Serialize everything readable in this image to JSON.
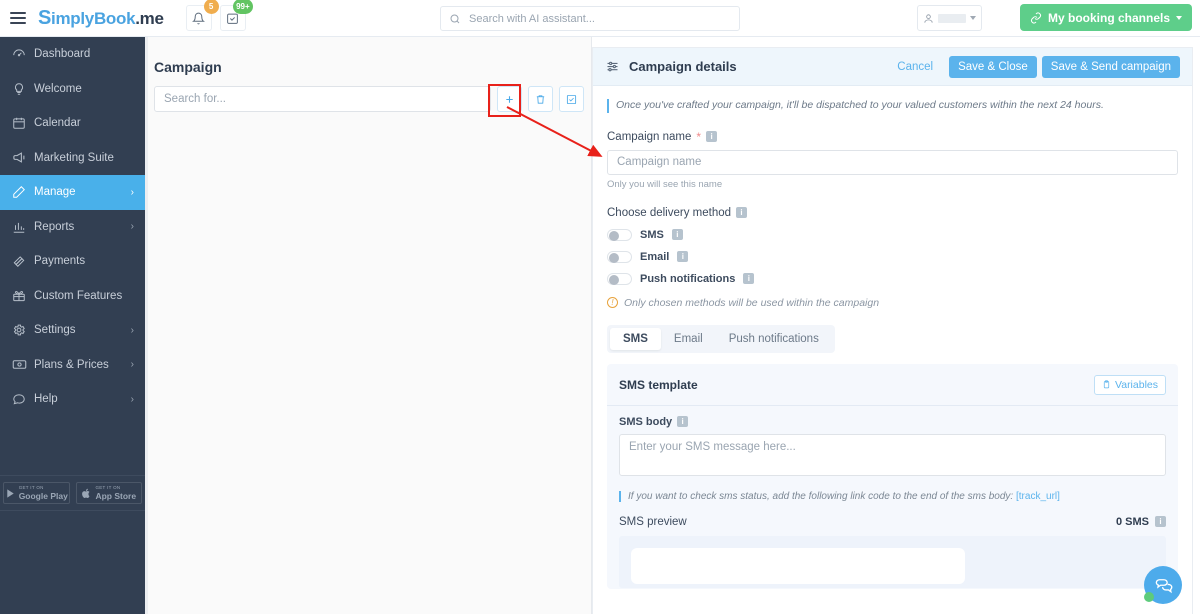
{
  "topbar": {
    "logo_simply": "implyBook",
    "logo_me": ".me",
    "notifications_badge": "5",
    "tasks_badge": "99+",
    "search_placeholder": "Search with AI assistant...",
    "search_value": "",
    "booking_channels_label": "My booking channels"
  },
  "sidebar": {
    "items": [
      {
        "label": "Dashboard",
        "icon": "dashboard-icon",
        "active": false,
        "arrow": false
      },
      {
        "label": "Welcome",
        "icon": "bulb-icon",
        "active": false,
        "arrow": false
      },
      {
        "label": "Calendar",
        "icon": "calendar-icon",
        "active": false,
        "arrow": false
      },
      {
        "label": "Marketing Suite",
        "icon": "megaphone-icon",
        "active": false,
        "arrow": false
      },
      {
        "label": "Manage",
        "icon": "pencil-icon",
        "active": true,
        "arrow": true
      },
      {
        "label": "Reports",
        "icon": "chart-icon",
        "active": false,
        "arrow": true
      },
      {
        "label": "Payments",
        "icon": "payments-icon",
        "active": false,
        "arrow": false
      },
      {
        "label": "Custom Features",
        "icon": "gift-icon",
        "active": false,
        "arrow": false
      },
      {
        "label": "Settings",
        "icon": "gear-icon",
        "active": false,
        "arrow": true
      },
      {
        "label": "Plans & Prices",
        "icon": "money-icon",
        "active": false,
        "arrow": true
      },
      {
        "label": "Help",
        "icon": "chat-icon",
        "active": false,
        "arrow": true
      }
    ],
    "stores": {
      "get_it_on": "GET IT ON",
      "google_play": "Google Play",
      "app_store": "App Store"
    }
  },
  "left": {
    "page_title": "Campaign",
    "search_placeholder": "Search for...",
    "search_value": "",
    "add_label": "+",
    "delete_icon": "trash-icon",
    "select_icon": "checkbox-icon"
  },
  "panel": {
    "title": "Campaign details",
    "cancel_label": "Cancel",
    "save_close_label": "Save & Close",
    "save_send_label": "Save & Send campaign",
    "note": "Once you've crafted your campaign, it'll be dispatched to your valued customers within the next 24 hours.",
    "campaign_name_label": "Campaign name",
    "campaign_name_required": "*",
    "campaign_name_placeholder": "Campaign name",
    "campaign_name_value": "",
    "campaign_name_hint": "Only you will see this name",
    "delivery_method_label": "Choose delivery method",
    "delivery_methods": [
      {
        "label": "SMS",
        "enabled": false
      },
      {
        "label": "Email",
        "enabled": false
      },
      {
        "label": "Push notifications",
        "enabled": false
      }
    ],
    "delivery_warning": "Only chosen methods will be used within the campaign",
    "tabs": [
      {
        "label": "SMS",
        "active": true
      },
      {
        "label": "Email",
        "active": false
      },
      {
        "label": "Push notifications",
        "active": false
      }
    ],
    "template_title": "SMS template",
    "variables_label": "Variables",
    "sms_body_label": "SMS body",
    "sms_body_placeholder": "Enter your SMS message here...",
    "sms_body_value": "",
    "track_hint_text": "If you want to check sms status, add the following link code to the end of the sms body:",
    "track_hint_link": "[track_url]",
    "preview_label": "SMS preview",
    "preview_count": "0 SMS"
  },
  "colors": {
    "accent_blue": "#5bb3ec",
    "sidebar_bg": "#323f52",
    "active_nav": "#49b0ea",
    "green_button": "#5ece8a",
    "annotation_red": "#e8211a",
    "warning_orange": "#e8a33d"
  }
}
